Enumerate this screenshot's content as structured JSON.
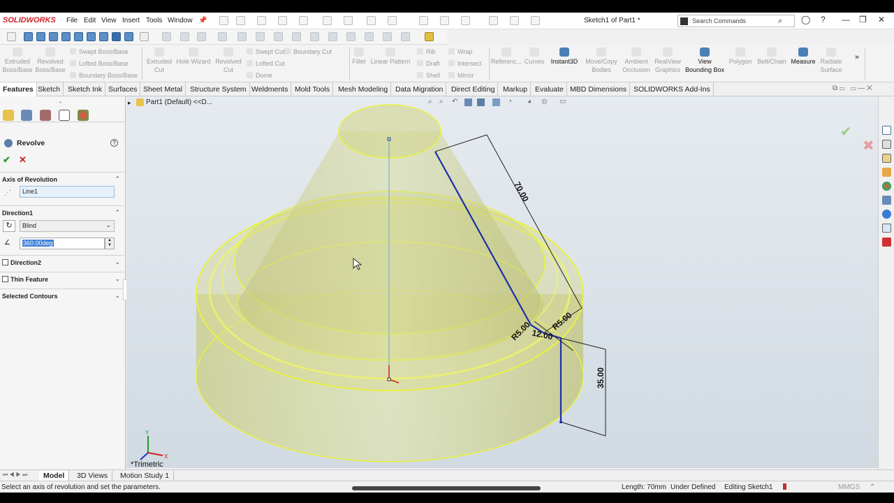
{
  "app": {
    "name": "SOLIDWORKS",
    "document_title": "Sketch1 of Part1 *"
  },
  "menu": [
    "File",
    "Edit",
    "View",
    "Insert",
    "Tools",
    "Window"
  ],
  "search": {
    "placeholder": "Search Commands"
  },
  "command_manager": {
    "tools": {
      "extruded_boss": "Extruded Boss/Base",
      "revolved_boss": "Revolved Boss/Base",
      "swept_boss": "Swept Boss/Base",
      "lofted_boss": "Lofted Boss/Base",
      "boundary_boss": "Boundary Boss/Base",
      "extruded_cut": "Extruded Cut",
      "hole_wizard": "Hole Wizard",
      "revolved_cut": "Revolved Cut",
      "swept_cut": "Swept Cut",
      "lofted_cut": "Lofted Cut",
      "boundary_cut": "Boundary Cut",
      "dome": "Dome",
      "fillet": "Fillet",
      "linear_pattern": "Linear Pattern",
      "rib": "Rib",
      "draft": "Draft",
      "shell": "Shell",
      "wrap": "Wrap",
      "intersect": "Intersect",
      "mirror": "Mirror",
      "reference": "Referenc...",
      "curves": "Curves",
      "instant3d": "Instant3D",
      "move_copy": "Move/Copy Bodies",
      "ambient": "Ambient Occlusion",
      "realview": "RealView Graphics",
      "view_bb": "View Bounding Box",
      "polygon": "Polygon",
      "belt_chain": "Belt/Chain",
      "measure": "Measure",
      "radiate": "Radiate Surface"
    }
  },
  "tabs": [
    "Features",
    "Sketch",
    "Sketch Ink",
    "Surfaces",
    "Sheet Metal",
    "Structure System",
    "Weldments",
    "Mold Tools",
    "Mesh Modeling",
    "Data Migration",
    "Direct Editing",
    "Markup",
    "Evaluate",
    "MBD Dimensions",
    "SOLIDWORKS Add-Ins"
  ],
  "property_manager": {
    "title": "Revolve",
    "axis_section": "Axis of Revolution",
    "axis_value": "Line1",
    "direction1": "Direction1",
    "end_condition": "Blind",
    "angle": "360.00deg",
    "direction2": "Direction2",
    "thin_feature": "Thin Feature",
    "selected_contours": "Selected Contours"
  },
  "graphics": {
    "tree_label": "Part1 (Default) <<D...",
    "view_orientation": "*Trimetric",
    "dims": {
      "d70": "70.00",
      "d12": "12.00",
      "r1": "R5.00",
      "r2": "R5.00",
      "d35": "35.00"
    },
    "model_color": "#e2e892",
    "edge_color": "#e9f23f",
    "sketch_color": "#1b2fa8"
  },
  "bottom_tabs": [
    "Model",
    "3D Views",
    "Motion Study 1"
  ],
  "status": {
    "message": "Select an axis of revolution and set the parameters.",
    "length": "Length: 70mm",
    "defined": "Under Defined",
    "editing": "Editing Sketch1",
    "units": "MMGS"
  }
}
